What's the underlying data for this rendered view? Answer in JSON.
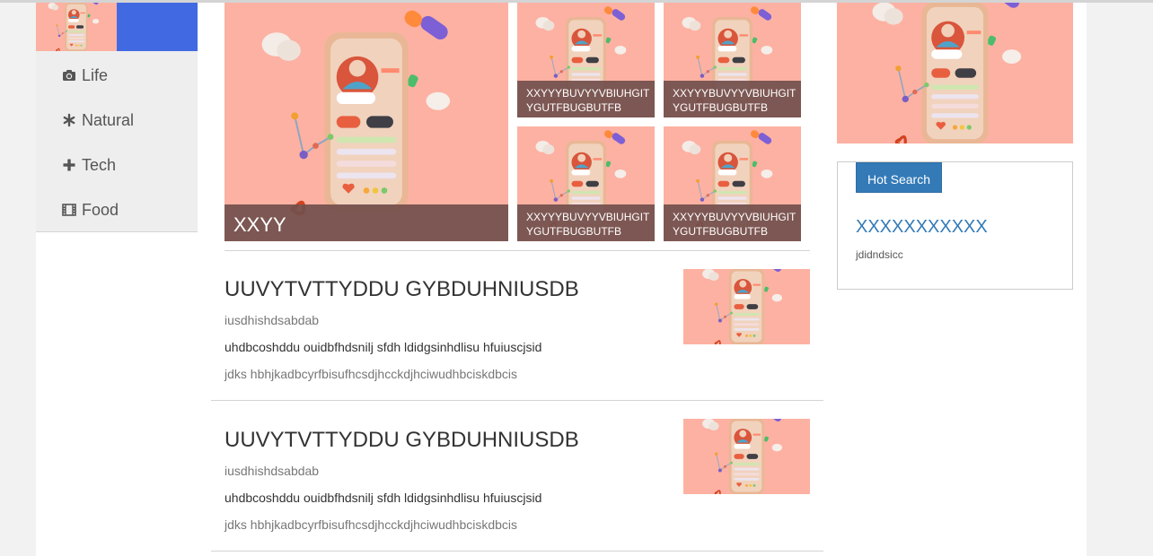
{
  "sidebar": {
    "items": [
      {
        "label": "Life",
        "icon": "camera-icon"
      },
      {
        "label": "Natural",
        "icon": "asterisk-icon"
      },
      {
        "label": "Tech",
        "icon": "plus-icon"
      },
      {
        "label": "Food",
        "icon": "film-icon"
      }
    ]
  },
  "banner": {
    "main_caption": "XXYY",
    "tiles": [
      {
        "caption": "XXYYYBUVYYVBIUHGITYGUTFBUGBUTFB"
      },
      {
        "caption": "XXYYYBUVYYVBIUHGITYGUTFBUGBUTFB"
      },
      {
        "caption": "XXYYYBUVYYVBIUHGITYGUTFBUGBUTFB"
      },
      {
        "caption": "XXYYYBUVYYVBIUHGITYGUTFBUGBUTFB"
      }
    ]
  },
  "articles": [
    {
      "title": "UUVYTVTTYDDU GYBDUHNIUSDB",
      "subtitle": "iusdhishdsabdab",
      "description": "uhdbcoshddu ouidbfhdsnilj sfdh ldidgsinhdlisu hfuiuscjsid",
      "meta": "jdks hbhjkadbcyrfbisufhcsdjhcckdjhciwudhbciskdbcis"
    },
    {
      "title": "UUVYTVTTYDDU GYBDUHNIUSDB",
      "subtitle": "iusdhishdsabdab",
      "description": "uhdbcoshddu ouidbfhdsnilj sfdh ldidgsinhdlisu hfuiuscjsid",
      "meta": "jdks hbhjkadbcyrfbisufhcsdjhcckdjhciwudhbciskdbcis"
    }
  ],
  "hot_search": {
    "button_label": "Hot Search",
    "link_text": "XXXXXXXXXXX",
    "description": "jdidndsicc"
  },
  "colors": {
    "accent_blue": "#4169e1",
    "button_blue": "#337ab7",
    "illustration_bg": "#fdb1a2",
    "caption_overlay": "#73504c"
  }
}
